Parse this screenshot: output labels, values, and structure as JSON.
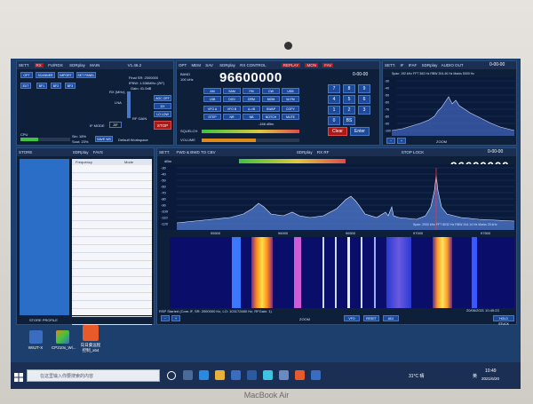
{
  "brand": "MacBook Air",
  "colors": {
    "accent": "#1c4a9a",
    "desktop": "#1d3f6e",
    "stop": "#b01818"
  },
  "top_left": {
    "tabs": [
      "SETT.",
      "RX",
      "FU/RDS",
      "SDRplay",
      "MAIN",
      "V1.46.2"
    ],
    "buttons": [
      "OPT",
      "SCANNER",
      "IMPORT",
      "SET PANEL",
      "EXT",
      "BF1",
      "BF2",
      "BF3"
    ],
    "final_sr": "Final SR: 2000000",
    "ifbw": "IFBW: 1.536MHz (ZIF)",
    "gain": "Gain: 41.0dB",
    "rx_label": "RX (MHz)",
    "lna": "LNA",
    "rf_gain": "RF GAIN",
    "side_buttons": [
      "AGC OFF",
      "DX",
      "LO LOW"
    ],
    "if_mode": "IF MODE",
    "zif": "ZIF",
    "stop": "STOP",
    "cpu": "CPU",
    "sin": "Sin: 18%",
    "sout": "Sout: 23%",
    "save": "SAVE WS",
    "workspace": "Default Workspace"
  },
  "center": {
    "tabs": [
      "OPT",
      "MEM",
      "SAV",
      "SDRplay",
      "RX CONTROL",
      "REPLAY",
      "MON",
      "FAV"
    ],
    "freq": "96600000",
    "clock": "0-00-00",
    "modes": [
      "AM",
      "SAM",
      "FM",
      "CW",
      "USB",
      "LSB",
      "DIGI",
      "DRM",
      "MOM",
      "W-FM"
    ],
    "buttons": [
      "VFO A",
      "VFO B",
      "A->B",
      "SWAP",
      "COPY",
      "STEP",
      "NR",
      "NB",
      "NOTCH",
      "MUTE"
    ],
    "squelch": "SQUELCH",
    "volume": "VOLUME",
    "db": "-166 dBm",
    "keypad": [
      "7",
      "8",
      "9",
      "4",
      "5",
      "6",
      "1",
      "2",
      "3",
      "0",
      "BS",
      "Clear",
      "Enter"
    ],
    "bw_label": "BAND",
    "bw_value": "100 kHz"
  },
  "top_right": {
    "tabs": [
      "SETT.",
      "IF",
      "IFAF",
      "SDRplay",
      "AUDIO OUT"
    ],
    "clock": "0-00-00",
    "info": "Span: 192 kHz  FFT 363 Hz  RBW 204.46 Hz  Marks 5000 Hz",
    "ticks": [
      "-30",
      "-40",
      "-50",
      "-60",
      "-70",
      "-80",
      "-90",
      "-100"
    ],
    "zoom": "ZOOM"
  },
  "side_panel": {
    "tabs": [
      "STORE",
      "SDRplay",
      "FAVS"
    ],
    "cols": [
      "Frequency",
      "Mode"
    ],
    "footer": "STORE PROFILE"
  },
  "main": {
    "tabs": [
      "SETT.",
      "FWD & BWD TO CBV",
      "SDRplay",
      "RX RF"
    ],
    "stop_lock": "STOP LOCK",
    "freq": "96600000",
    "clock": "0-00-00",
    "dbm": "dBm",
    "levels": "-67.1 dBm   SNR: 27.8 dB",
    "yticks": [
      "-30",
      "-40",
      "-50",
      "-60",
      "-70",
      "-80",
      "-90",
      "-100",
      "-110",
      "-120"
    ],
    "xticks": [
      "95500",
      "96000",
      "96500",
      "97000",
      "97500"
    ],
    "span": "Span: 2000 kHz  FFT 8032 Hz  RBW 244.14 Hz  Marks 25 kHz",
    "status": "RSP Started (Core-IF, SR: 2000000 Hz, LO: 103172480 Hz, RFGain: 1)",
    "datetime": "20/06/2021 10:49:23",
    "bottom_buttons": [
      "ZOOM",
      "VFO",
      "RESET",
      "ADJ"
    ],
    "hold": "HOLD STUCK"
  },
  "desktop_icons": [
    {
      "label": "WSJT-X",
      "color": "#3a6dc0"
    },
    {
      "label": "CP210x_Wi...",
      "color": "#e08a1a"
    },
    {
      "label": "向日葵远程控制_x64",
      "color": "#e85a2a"
    }
  ],
  "taskbar": {
    "search_placeholder": "在这里输入你要搜索的内容",
    "weather": "31°C 晴",
    "time": "10:49",
    "date": "2021/6/20",
    "lang": "英"
  }
}
